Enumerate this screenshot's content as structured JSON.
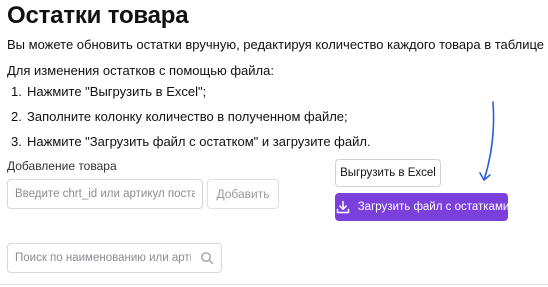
{
  "page": {
    "title": "Остатки товара",
    "intro": "Вы можете обновить остатки вручную, редактируя количество каждого товара в таблице или через файл .xlsx",
    "file_heading": "Для изменения остатков с помощью файла:",
    "steps": [
      {
        "num": "1.",
        "text": "Нажмите \"Выгрузить в Excel\";"
      },
      {
        "num": "2.",
        "text": "Заполните колонку количество в полученном файле;"
      },
      {
        "num": "3.",
        "text": "Нажмите \"Загрузить файл с остатком\" и загрузите файл."
      }
    ]
  },
  "add_product": {
    "label": "Добавление товара",
    "input_value": "",
    "input_placeholder": "Введите chrt_id или артикул поставщика",
    "button_label": "Добавить"
  },
  "actions": {
    "export_label": "Выгрузить в Excel",
    "upload_label": "Загрузить файл с остатками",
    "upload_icon": "download-tray-icon"
  },
  "search": {
    "value": "",
    "placeholder": "Поиск по наименованию или артикулу",
    "icon": "search-icon"
  },
  "colors": {
    "accent": "#7b3fdc",
    "annotation_arrow": "#2f5fe0",
    "border": "#d7d7dc"
  }
}
